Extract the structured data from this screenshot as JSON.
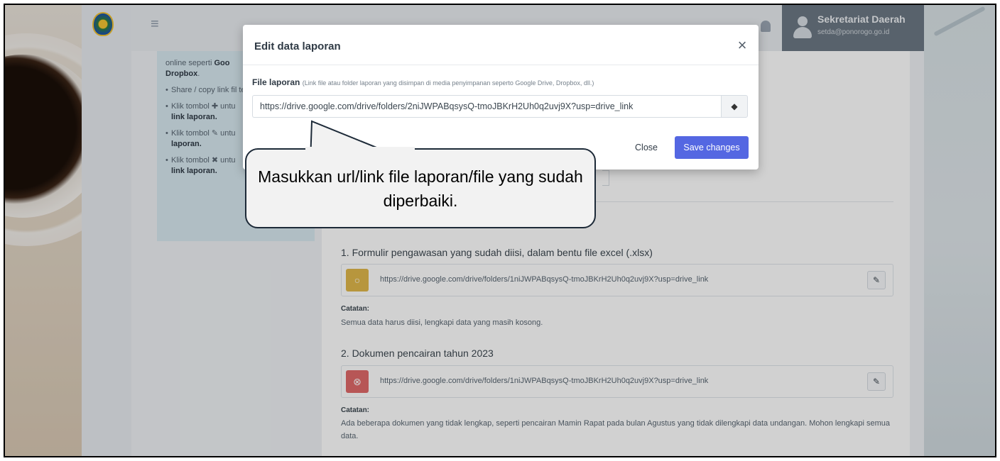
{
  "navbar": {
    "user_name": "Sekretariat Daerah",
    "user_email": "setda@ponorogo.go.id"
  },
  "help": {
    "intro_text": "online seperti ",
    "intro_bold": "Goo",
    "intro_bold2": "Dropbox",
    "items": [
      {
        "text": "Share / copy link fil telah diupload.",
        "bold": ""
      },
      {
        "text": "Klik tombol ✚ untu",
        "bold": "link laporan."
      },
      {
        "text": "Klik tombol ✎ untu",
        "bold": "laporan."
      },
      {
        "text": "Klik tombol ✖ untu",
        "bold": "link laporan."
      }
    ]
  },
  "main": {
    "sections": [
      {
        "title": "1. Formulir pengawasan yang sudah diisi, dalam bentu file excel (.xlsx)",
        "link": "https://drive.google.com/drive/folders/1niJWPABqsysQ-tmoJBKrH2Uh0q2uvj9X?usp=drive_link",
        "status_color": "#e0b84b",
        "status_icon": "circle-icon",
        "note_label": "Catatan:",
        "note": "Semua data harus diisi, lengkapi data yang masih kosong."
      },
      {
        "title": "2. Dokumen pencairan tahun 2023",
        "link": "https://drive.google.com/drive/folders/1niJWPABqsysQ-tmoJBKrH2Uh0q2uvj9X?usp=drive_link",
        "status_color": "#e06a6a",
        "status_icon": "x-circle-icon",
        "note_label": "Catatan:",
        "note": "Ada beberapa dokumen yang tidak lengkap, seperti pencairan Mamin Rapat pada bulan Agustus yang tidak dilengkapi data undangan. Mohon lengkapi semua data."
      }
    ]
  },
  "modal": {
    "title": "Edit data laporan",
    "field_label": "File laporan",
    "field_hint": "(Link file atau folder laporan yang disimpan di media penyimpanan seperto Google Drive, Dropbox, dll.)",
    "url_value": "https://drive.google.com/drive/folders/2niJWPABqsysQ-tmoJBKrH2Uh0q2uvj9X?usp=drive_link",
    "close_label": "Close",
    "save_label": "Save changes",
    "accent": "#5467e2"
  },
  "callout": {
    "text": "Masukkan url/link file laporan/file yang sudah diperbaiki."
  }
}
